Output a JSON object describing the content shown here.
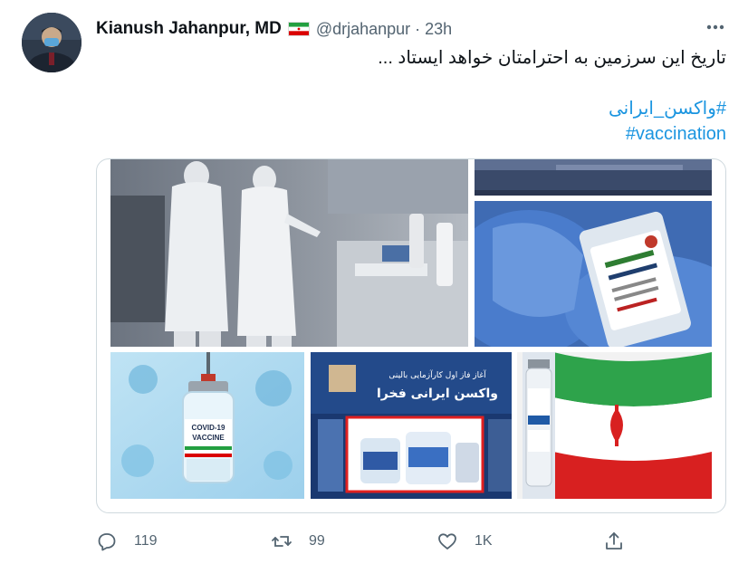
{
  "user": {
    "name": "Kianush Jahanpur, MD",
    "handle": "@drjahanpur",
    "separator": "·",
    "time": "23h",
    "flag_icon": "iran-flag-icon"
  },
  "tweet": {
    "text": "تاریخ این سرزمین به احترامتان خواهد ایستاد ...",
    "hashtags": [
      "#واکسن_ایرانی",
      "#vaccination"
    ]
  },
  "media": {
    "tiles": [
      {
        "name": "lab-workers-photo"
      },
      {
        "name": "lab-equipment-photo"
      },
      {
        "name": "covid-vaccine-bottle-photo"
      },
      {
        "name": "covid-vaccine-vial-photo"
      },
      {
        "name": "vaccine-trial-launch-photo"
      },
      {
        "name": "iran-flag-vaccine-photo"
      }
    ],
    "vial_label_1": "COVID-19",
    "vial_label_2": "VACCINE",
    "banner_line_1": "آغاز فاز اول کارآزمایی بالینی",
    "banner_line_2": "واکسن ایرانی فخرا"
  },
  "actions": {
    "reply_count": "119",
    "retweet_count": "99",
    "like_count": "1K"
  },
  "colors": {
    "accent": "#1b95e0",
    "muted": "#536471"
  }
}
